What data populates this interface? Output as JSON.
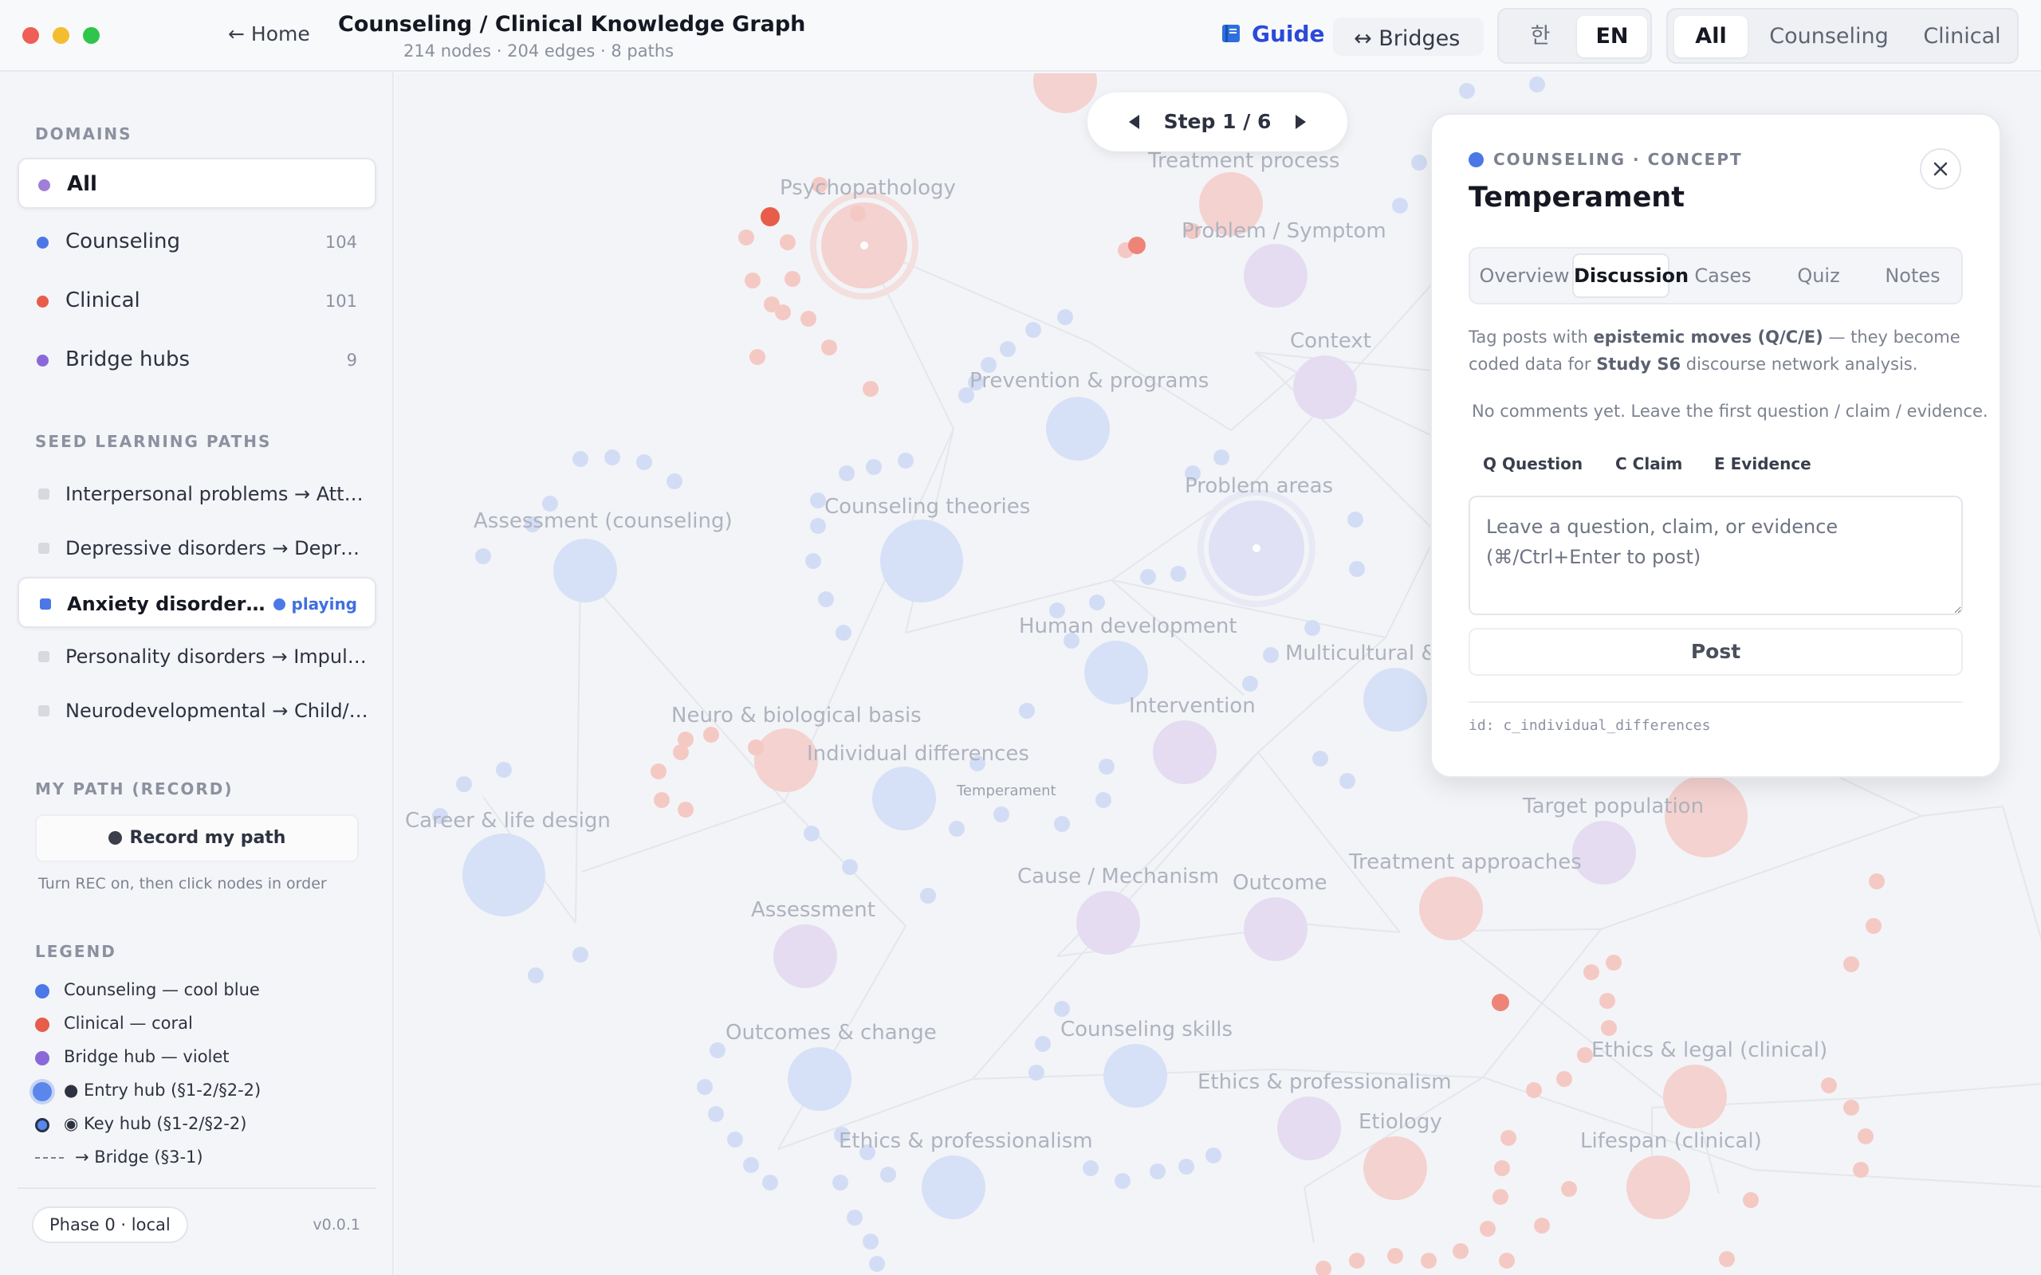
{
  "header": {
    "home_label": "← Home",
    "title": "Counseling / Clinical Knowledge Graph",
    "stats": "214 nodes · 204 edges · 8 paths",
    "guide_label": "Guide",
    "bridges_label": "↔ Bridges",
    "lang_options": [
      "한",
      "EN"
    ],
    "lang_selected": "EN",
    "scope_options": [
      "All",
      "Counseling",
      "Clinical"
    ],
    "scope_selected": "All"
  },
  "sidebar": {
    "domains_heading": "DOMAINS",
    "domains": [
      {
        "label": "All",
        "count": "",
        "color": "#9f7fd8"
      },
      {
        "label": "Counseling",
        "count": "104",
        "color": "#4b78e6"
      },
      {
        "label": "Clinical",
        "count": "101",
        "color": "#e85c4a"
      },
      {
        "label": "Bridge hubs",
        "count": "9",
        "color": "#8b68d8"
      }
    ],
    "paths_heading": "SEED LEARNING PATHS",
    "paths": [
      {
        "label": "Interpersonal problems → Attachment"
      },
      {
        "label": "Depressive disorders → Depression"
      },
      {
        "label": "Anxiety disorders → Anxiety"
      },
      {
        "label": "Personality disorders → Impulsivity"
      },
      {
        "label": "Neurodevelopmental → Child/adolescent"
      }
    ],
    "active_path_status": "playing",
    "record_heading": "MY PATH (RECORD)",
    "record_button": "Record my path",
    "record_hint": "Turn REC on, then click nodes in order",
    "legend_heading": "LEGEND",
    "legend": [
      "Counseling — cool blue",
      "Clinical — coral",
      "Bridge hub — violet",
      "● Entry hub (§1-2/§2-2)",
      "◉ Key hub (§1-2/§2-2)",
      "→ Bridge (§3-1)"
    ],
    "phase": "Phase 0 · local",
    "version": "v0.0.1"
  },
  "colors": {
    "counseling": "#4b78e6",
    "clinical": "#e85c4a",
    "bridge": "#8b68d8",
    "guide": "#2c4ad8"
  },
  "graph": {
    "labels": {
      "psychopathology": "Psychopathology",
      "treatment_process": "Treatment process",
      "problem_symptom": "Problem / Symptom",
      "context": "Context",
      "prevention": "Prevention & programs",
      "assessment_counseling": "Assessment (counseling)",
      "counseling_theories": "Counseling theories",
      "problem_areas": "Problem areas",
      "human_development": "Human development",
      "multicultural": "Multicultural &",
      "neuro": "Neuro & biological basis",
      "intervention": "Intervention",
      "individual_differences": "Individual differences",
      "temperament": "Temperament",
      "career": "Career & life design",
      "target_population": "Target population",
      "treatment_approaches": "Treatment approaches",
      "cause": "Cause / Mechanism",
      "outcome": "Outcome",
      "assessment": "Assessment",
      "outcomes_change": "Outcomes & change",
      "counseling_skills": "Counseling skills",
      "ethics_prof_1": "Ethics & professionalism",
      "ethics_legal_clinical": "Ethics & legal (clinical)",
      "etiology": "Etiology",
      "ethics_prof_2": "Ethics & professionalism",
      "lifespan_clinical": "Lifespan (clinical)"
    }
  },
  "stepper": {
    "text": "Step 1 / 6"
  },
  "panel": {
    "kicker": "COUNSELING · CONCEPT",
    "title": "Temperament",
    "tabs": [
      "Overview",
      "Discussion",
      "Cases",
      "Quiz",
      "Notes"
    ],
    "active_tab": "Discussion",
    "desc_1": "Tag posts with ",
    "desc_bold_1": "epistemic moves (Q/C/E)",
    "desc_2": " — they become coded data for ",
    "desc_bold_2": "Study S6",
    "desc_3": " discourse network analysis.",
    "empty": "No comments yet. Leave the first question / claim / evidence.",
    "chips": [
      {
        "key": "Q",
        "label": "Question"
      },
      {
        "key": "C",
        "label": "Claim"
      },
      {
        "key": "E",
        "label": "Evidence"
      }
    ],
    "placeholder": "Leave a question, claim, or evidence (⌘/Ctrl+Enter to post)",
    "post_label": "Post",
    "id_text": "id: c_individual_differences"
  }
}
